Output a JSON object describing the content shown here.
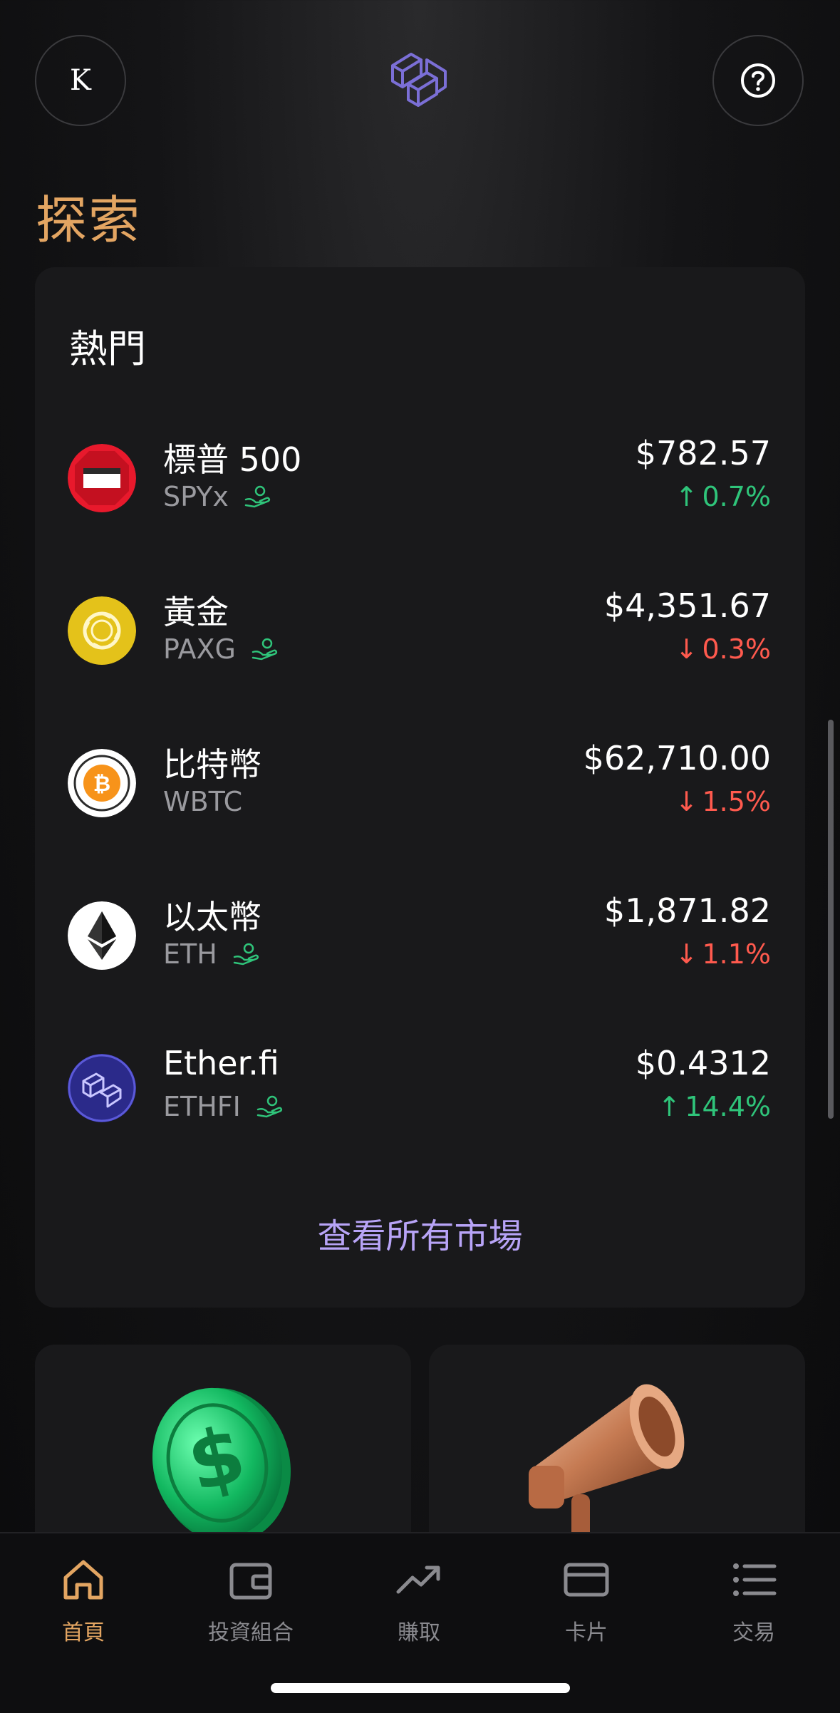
{
  "header": {
    "avatar_initial": "K",
    "help_icon": "question-circle-icon",
    "logo_icon": "etherfi-logo-icon"
  },
  "page_title": "探索",
  "trending": {
    "title": "熱門",
    "items": [
      {
        "name": "標普 500",
        "ticker": "SPYx",
        "earn": true,
        "price": "$782.57",
        "change": "0.7%",
        "direction": "up",
        "icon": "spyx-token-icon"
      },
      {
        "name": "黃金",
        "ticker": "PAXG",
        "earn": true,
        "price": "$4,351.67",
        "change": "0.3%",
        "direction": "down",
        "icon": "paxg-token-icon"
      },
      {
        "name": "比特幣",
        "ticker": "WBTC",
        "earn": false,
        "price": "$62,710.00",
        "change": "1.5%",
        "direction": "down",
        "icon": "wbtc-token-icon"
      },
      {
        "name": "以太幣",
        "ticker": "ETH",
        "earn": true,
        "price": "$1,871.82",
        "change": "1.1%",
        "direction": "down",
        "icon": "eth-token-icon"
      },
      {
        "name": "Ether.fi",
        "ticker": "ETHFI",
        "earn": true,
        "price": "$0.4312",
        "change": "14.4%",
        "direction": "up",
        "icon": "ethfi-token-icon"
      }
    ],
    "view_all_label": "查看所有市場"
  },
  "promos": [
    {
      "icon": "green-dollar-coin-icon"
    },
    {
      "icon": "megaphone-icon"
    }
  ],
  "tabbar": {
    "tabs": [
      {
        "label": "首頁",
        "icon": "home-icon",
        "active": true
      },
      {
        "label": "投資組合",
        "icon": "wallet-icon",
        "active": false
      },
      {
        "label": "賺取",
        "icon": "trending-up-icon",
        "active": false
      },
      {
        "label": "卡片",
        "icon": "card-icon",
        "active": false
      },
      {
        "label": "交易",
        "icon": "list-icon",
        "active": false
      }
    ]
  },
  "colors": {
    "accent": "#e3a562",
    "up": "#2fc47a",
    "down": "#ff5a4e",
    "link": "#b8a4f7"
  }
}
